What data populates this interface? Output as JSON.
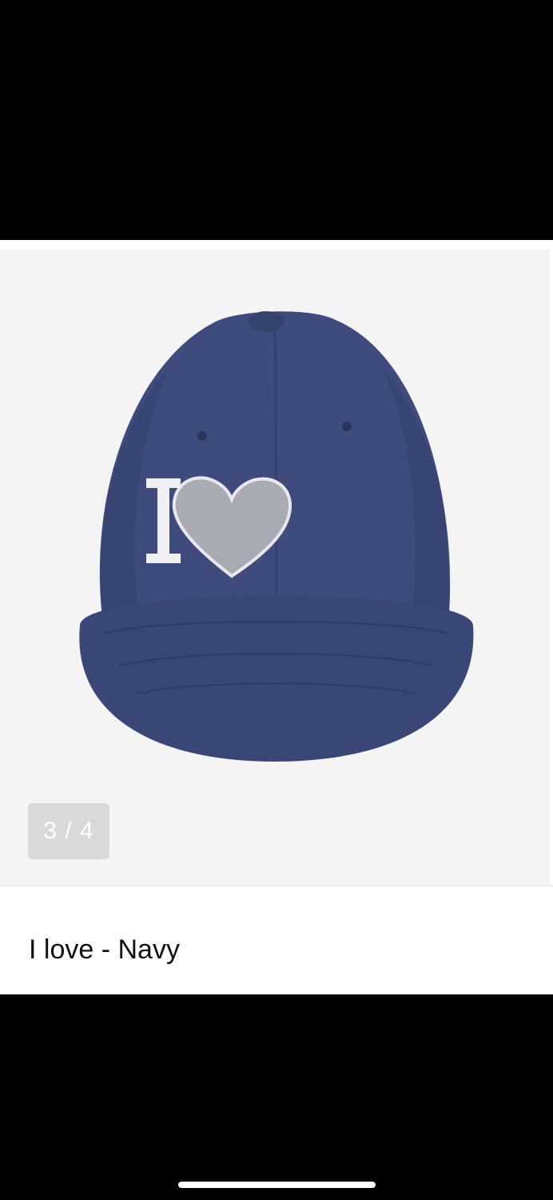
{
  "gallery": {
    "counter": "3 / 4",
    "image_alt": "Navy baseball cap with embroidered I and heart",
    "colors": {
      "background": "#f4f4f5",
      "cap": "#3e4a7a",
      "embroidery_letter": "#f0f0f2",
      "embroidery_heart": "#a7a9b3"
    }
  },
  "product": {
    "title": "I love - Navy"
  }
}
